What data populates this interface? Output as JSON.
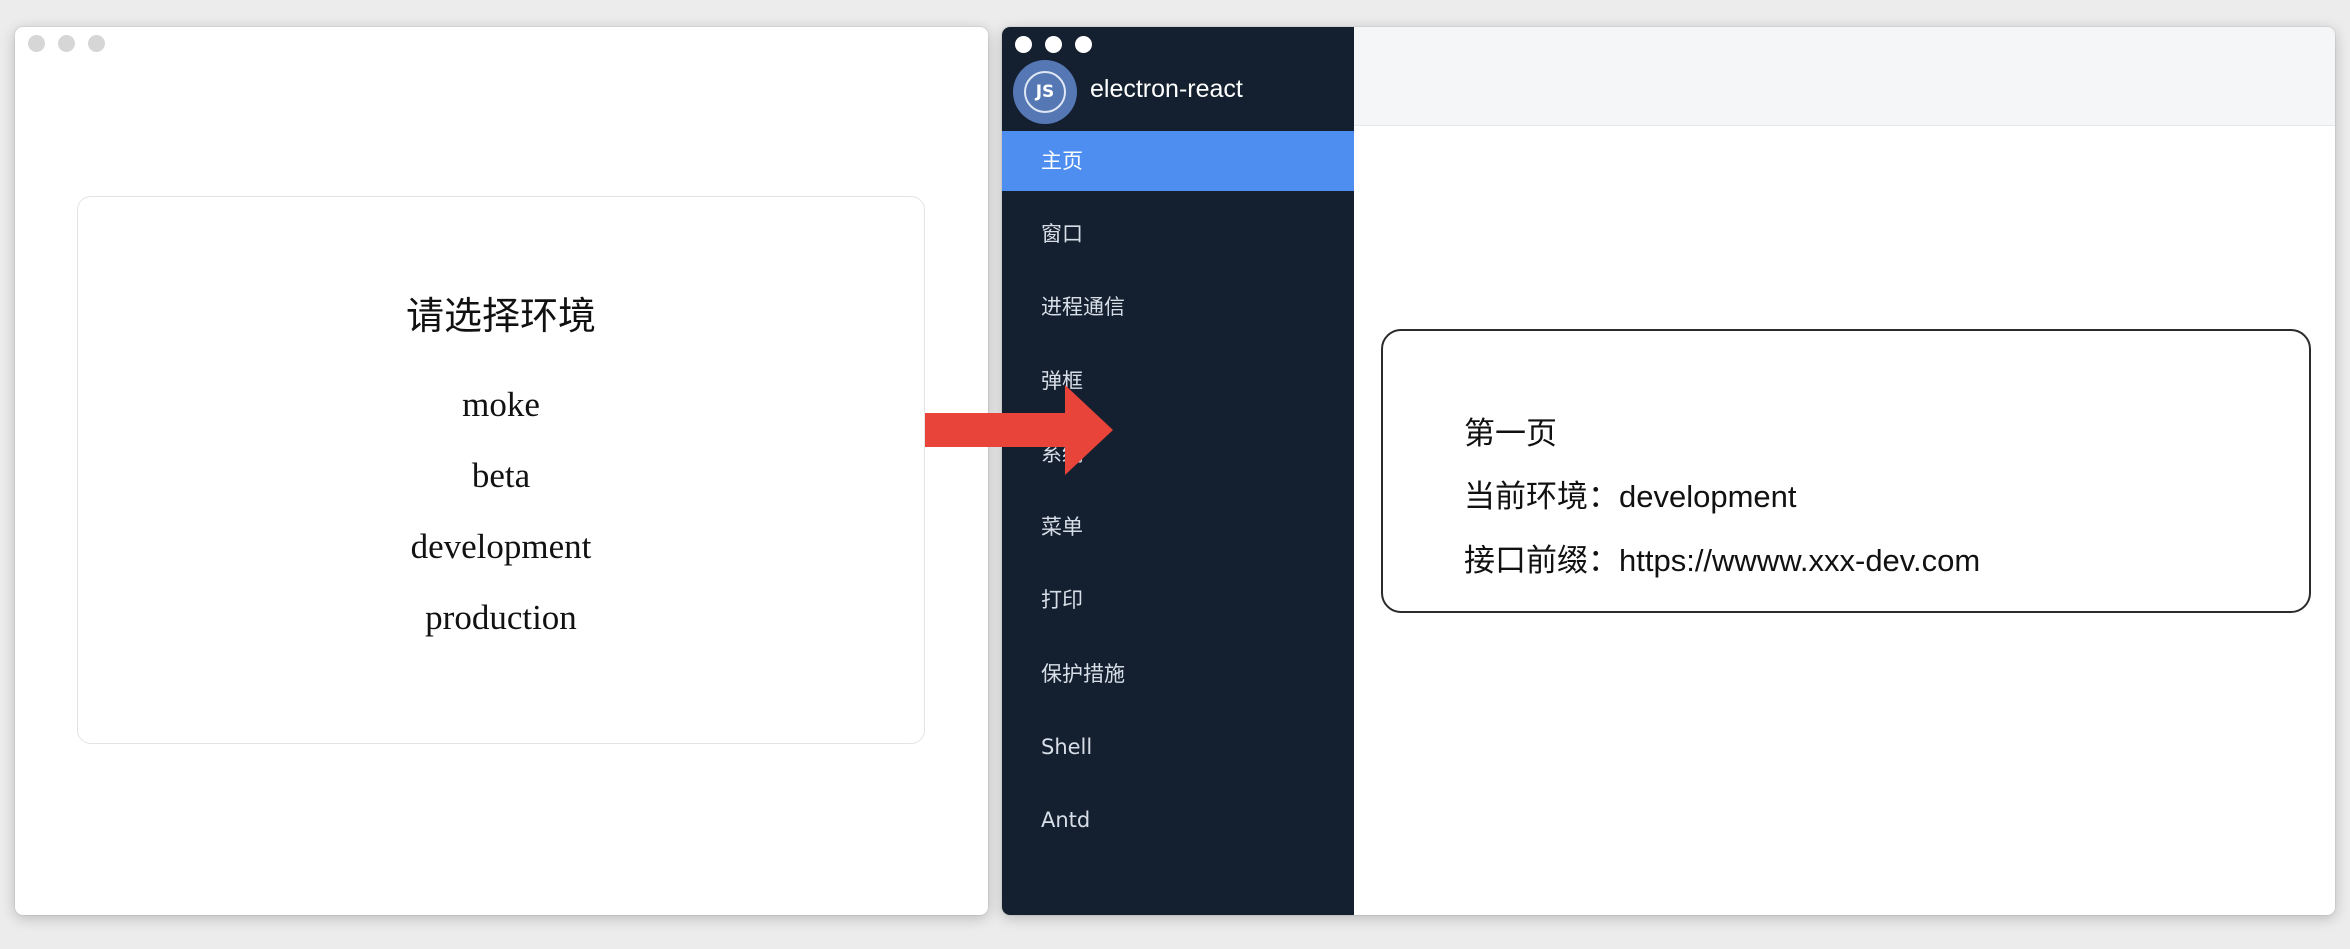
{
  "left_window": {
    "title": "请选择环境",
    "options": [
      "moke",
      "beta",
      "development",
      "production"
    ]
  },
  "right_window": {
    "app_name": "electron-react",
    "logo_text": "JS",
    "menu": [
      {
        "label": "主页",
        "active": true
      },
      {
        "label": "窗口"
      },
      {
        "label": "进程通信"
      },
      {
        "label": "弹框"
      },
      {
        "label": "系统"
      },
      {
        "label": "菜单"
      },
      {
        "label": "打印"
      },
      {
        "label": "保护措施"
      },
      {
        "label": "Shell"
      },
      {
        "label": "Antd"
      }
    ],
    "page": {
      "title": "第一页",
      "env_label": "当前环境：",
      "env_value": "development",
      "api_label": "接口前缀：",
      "api_value": "https://wwww.xxx-dev.com"
    }
  },
  "colors": {
    "sidebar_bg": "#14202f",
    "active_item": "#4e8ef0",
    "arrow": "#e8443a"
  },
  "icons": [
    "arrow-right-icon",
    "nodejs-logo-icon"
  ]
}
